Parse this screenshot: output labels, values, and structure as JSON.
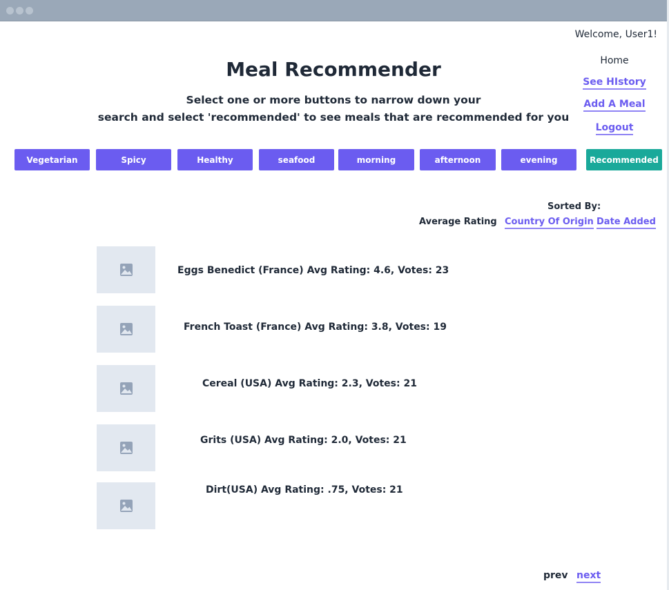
{
  "header": {
    "welcome": "Welcome, User1!",
    "title": "Meal Recommender",
    "subtitle_line1": "Select one or more buttons to narrow down your",
    "subtitle_line2": "search and select 'recommended' to see meals that are recommended for you"
  },
  "nav": {
    "home": "Home",
    "history": "See HIstory",
    "add_meal": "Add A Meal",
    "logout": "Logout"
  },
  "filters": [
    "Vegetarian",
    "Spicy",
    "Healthy",
    "seafood",
    "morning",
    "afternoon",
    "evening"
  ],
  "recommended_label": "Recommended",
  "sort": {
    "label": "Sorted By:",
    "options": [
      "Average Rating",
      "Country Of Origin",
      "Date Added"
    ]
  },
  "meals": [
    "Eggs Benedict (France) Avg Rating: 4.6, Votes: 23",
    "French Toast (France) Avg Rating: 3.8, Votes: 19",
    "Cereal (USA) Avg Rating: 2.3, Votes: 21",
    "Grits (USA) Avg Rating: 2.0, Votes: 21",
    "Dirt(USA) Avg Rating: .75, Votes: 21"
  ],
  "pagination": {
    "prev": "prev",
    "next": "next"
  },
  "colors": {
    "accent": "#6b5cf0",
    "recommended": "#1aa99a",
    "thumb_bg": "#e2e8f0",
    "titlebar": "#9aa8b8"
  },
  "icons": {
    "thumbnail": "image-placeholder-icon",
    "window_controls": "window-dot-icon"
  }
}
